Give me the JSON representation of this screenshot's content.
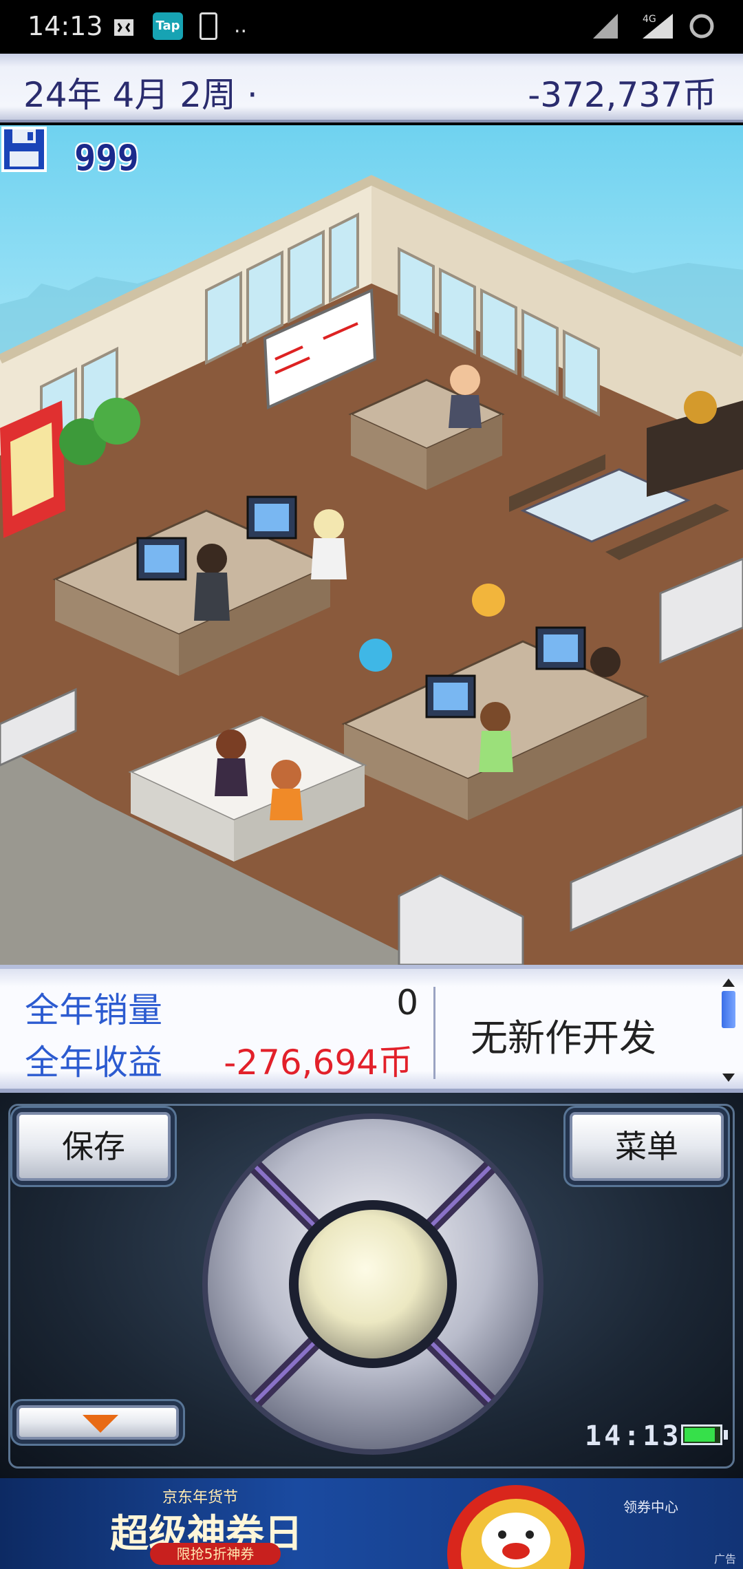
{
  "status_bar": {
    "time": "14:13",
    "icons": [
      "game-controller-icon",
      "tap-icon",
      "download-icon",
      "more-icon",
      "signal-icon",
      "signal-4g-icon",
      "battery-ring-icon"
    ],
    "tap_label": "Tap",
    "network_label": "4G",
    "more": ".."
  },
  "top_bar": {
    "date": "24年 4月 2周 ·",
    "funds": "-372,737币"
  },
  "scene": {
    "save_disk_icon": "floppy-disk-icon",
    "disk_count": "999"
  },
  "stats": {
    "annual_sales_label": "全年销量",
    "annual_sales_value": "0",
    "annual_profit_label": "全年收益",
    "annual_profit_value": "-276,694币",
    "development_status": "无新作开发"
  },
  "controls": {
    "save_label": "保存",
    "menu_label": "菜单",
    "clock": "14:13",
    "down_icon": "triangle-down-icon"
  },
  "ad": {
    "subtitle": "京东年货节",
    "title": "超级神券日",
    "pill": "限抢5折神券",
    "right_text": "领券中心",
    "tag": "广告"
  },
  "colors": {
    "date_text": "#2a2c6e",
    "stat_label": "#2c5bd0",
    "profit_negative": "#e2202a"
  }
}
